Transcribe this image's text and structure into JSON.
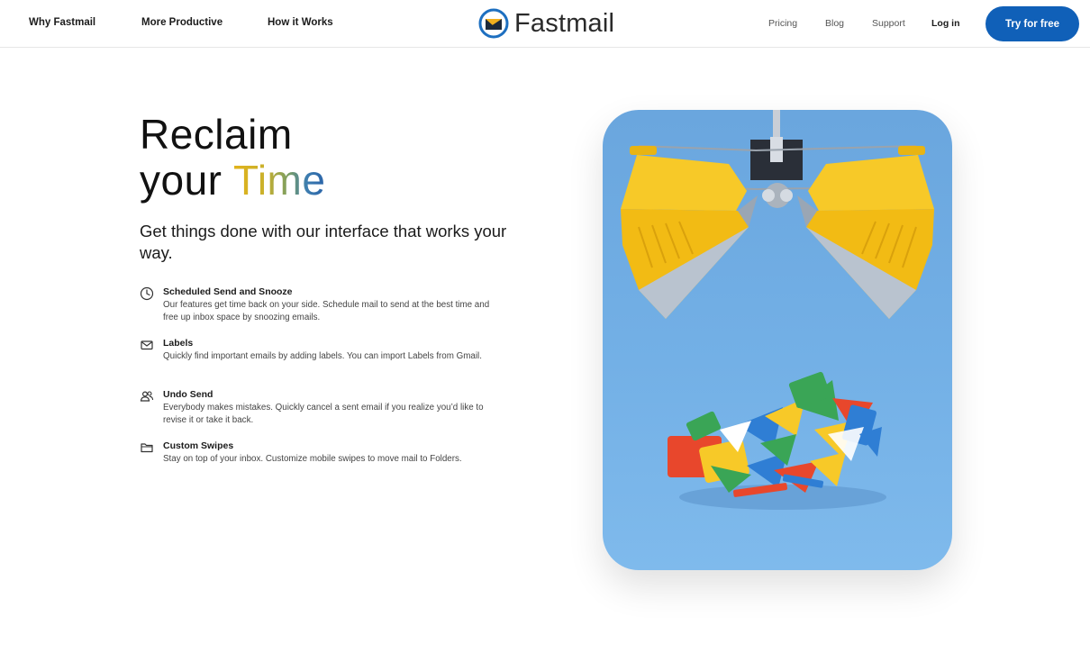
{
  "nav": {
    "left": [
      "Why Fastmail",
      "More Productive",
      "How it Works"
    ],
    "brand": "Fastmail",
    "right": [
      "Pricing",
      "Blog",
      "Support"
    ],
    "login": "Log in",
    "cta": "Try for free"
  },
  "hero": {
    "title_line1": "Reclaim",
    "title_line2_a": "your ",
    "title_line2_b": "Time",
    "subtitle": "Get things done with our interface that works your way."
  },
  "features": [
    {
      "icon": "clock-icon",
      "title": "Scheduled Send and Snooze",
      "description": "Our features get time back on your side. Schedule mail to send at the best time and free up inbox space by snoozing emails."
    },
    {
      "icon": "envelope-icon",
      "title": "Labels",
      "description": "Quickly find important emails by adding labels. You can import Labels from Gmail."
    },
    {
      "icon": "users-icon",
      "title": "Undo Send",
      "description": "Everybody makes mistakes. Quickly cancel a sent email if you realize you’d like to revise it or take it back."
    },
    {
      "icon": "folder-icon",
      "title": "Custom Swipes",
      "description": "Stay on top of your inbox. Customize mobile swipes to move mail to Folders."
    }
  ],
  "colors": {
    "cta_background": "#1060b8",
    "card_background": "#6aa6de",
    "claw_yellow": "#f5c21b"
  }
}
